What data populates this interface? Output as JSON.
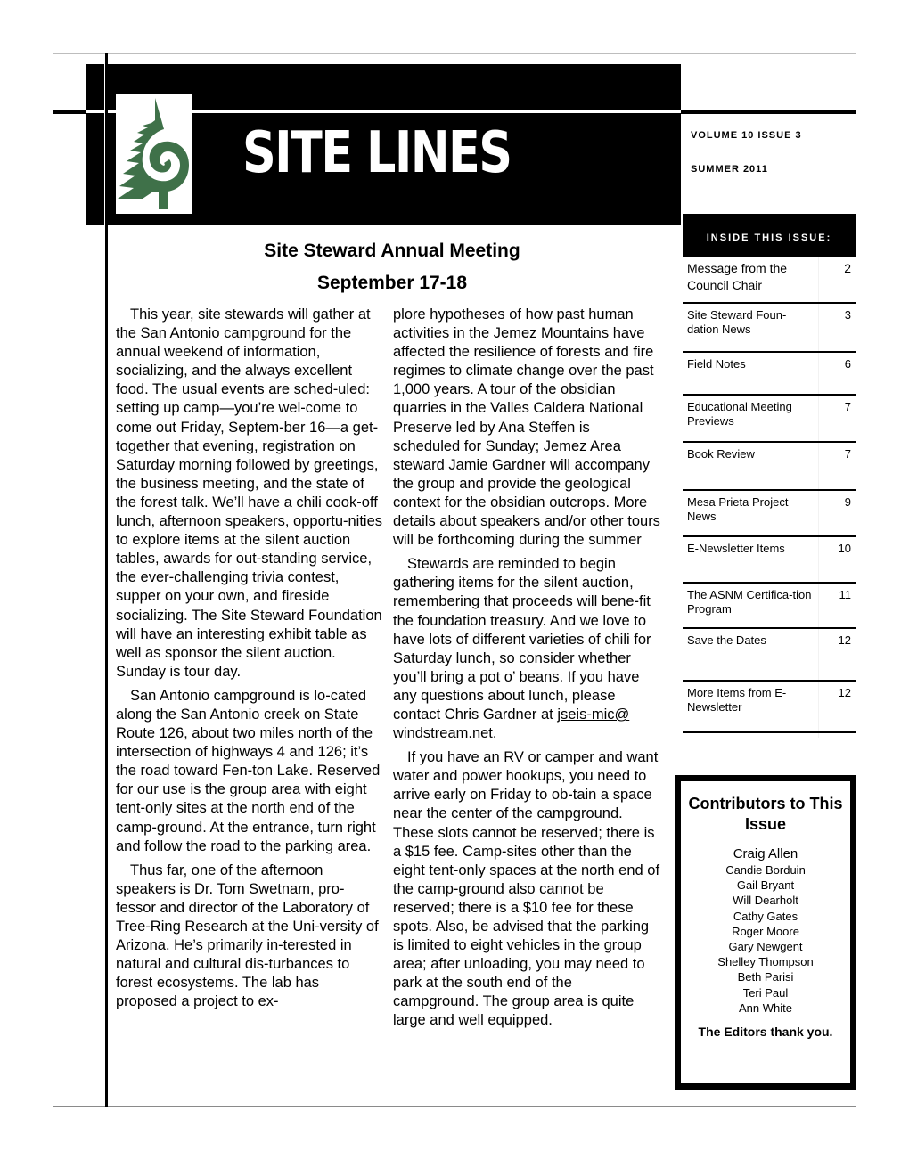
{
  "masthead": {
    "title": "SITE LINES",
    "volume_issue": "VOLUME 10  ISSUE 3",
    "season": "SUMMER 2011",
    "logo_color": "#3f7149"
  },
  "toc": {
    "header": "INSIDE THIS ISSUE:",
    "items": [
      {
        "label": "Message from the Council Chair",
        "page": "2"
      },
      {
        "label": "Site Steward Foun-dation News",
        "page": "3"
      },
      {
        "label": "Field Notes",
        "page": "6"
      },
      {
        "label": "Educational Meeting Previews",
        "page": "7"
      },
      {
        "label": "Book Review",
        "page": "7"
      },
      {
        "label": "Mesa Prieta Project News",
        "page": "9"
      },
      {
        "label": "E-Newsletter Items",
        "page": "10"
      },
      {
        "label": "The ASNM Certifica-tion Program",
        "page": "11"
      },
      {
        "label": "Save the Dates",
        "page": "12"
      },
      {
        "label": "More Items from E-Newsletter",
        "page": "12"
      }
    ]
  },
  "article": {
    "headline": "Site Steward Annual Meeting",
    "subhead": "September 17-18",
    "col1": [
      "This year, site stewards will gather at the San Antonio campground for the annual weekend of information, socializing, and the always excellent food. The usual events are sched-uled: setting up camp—you’re wel-come to come out Friday, Septem-ber 16—a get-together that evening, registration on Saturday morning followed by greetings, the business meeting, and the state of the forest talk. We’ll have a chili cook-off lunch, afternoon speakers, opportu-nities to explore items at the silent auction tables, awards for out-standing service, the ever-challenging trivia contest, supper on your own, and fireside socializing. The Site Steward Foundation will have an interesting exhibit table as well as sponsor the silent auction. Sunday is tour day.",
      "San Antonio campground is lo-cated along the San Antonio creek on State Route 126, about two miles north of the intersection of highways 4 and 126; it’s the road toward Fen-ton Lake. Reserved for our use is the group area with eight tent-only sites at the north end of the camp-ground. At the entrance, turn right and follow the road to the parking area.",
      "Thus far, one of the afternoon speakers is Dr. Tom Swetnam, pro-fessor and director of the Laboratory of Tree-Ring Research at the Uni-versity of Arizona. He’s primarily in-terested in natural and cultural dis-turbances to forest ecosystems. The lab has proposed a project to ex-"
    ],
    "col2": [
      "plore hypotheses of how past human activities in the Jemez Mountains have affected the resilience of forests and fire regimes to climate change over the past 1,000 years. A tour of the obsidian quarries in the Valles Caldera National Preserve led by Ana Steffen is scheduled for Sunday; Jemez Area steward Jamie Gardner will accompany the group and provide the geological context for the obsidian outcrops. More details about speakers and/or other tours will be forthcoming during the summer",
      "Stewards are reminded to begin gathering items for the silent auction, remembering that proceeds will bene-fit the foundation treasury. And we love to have lots of different varieties of chili for Saturday lunch, so consider whether you’ll bring a pot o’ beans. If you have any questions about lunch, please contact Chris Gardner at ",
      "If you have an RV or camper and want water and power hookups, you need to arrive early on Friday to ob-tain a space near the center of the campground. These slots cannot be reserved; there is a $15 fee. Camp-sites other than the eight tent-only spaces at the north end of the camp-ground also cannot be reserved; there is a $10 fee for these spots. Also, be advised that the parking is limited to eight vehicles in the group area; after unloading, you may need to park at the south end of the campground. The group area is quite large and well equipped."
    ],
    "email_link": "jseis-mic@ windstream.net."
  },
  "contributors": {
    "title": "Contributors to This Issue",
    "names": [
      "Craig Allen",
      "Candie Borduin",
      "Gail Bryant",
      "Will Dearholt",
      "Cathy Gates",
      "Roger Moore",
      "Gary Newgent",
      "Shelley Thompson",
      "Beth Parisi",
      "Teri Paul",
      "Ann White"
    ],
    "thanks": "The Editors thank you."
  }
}
